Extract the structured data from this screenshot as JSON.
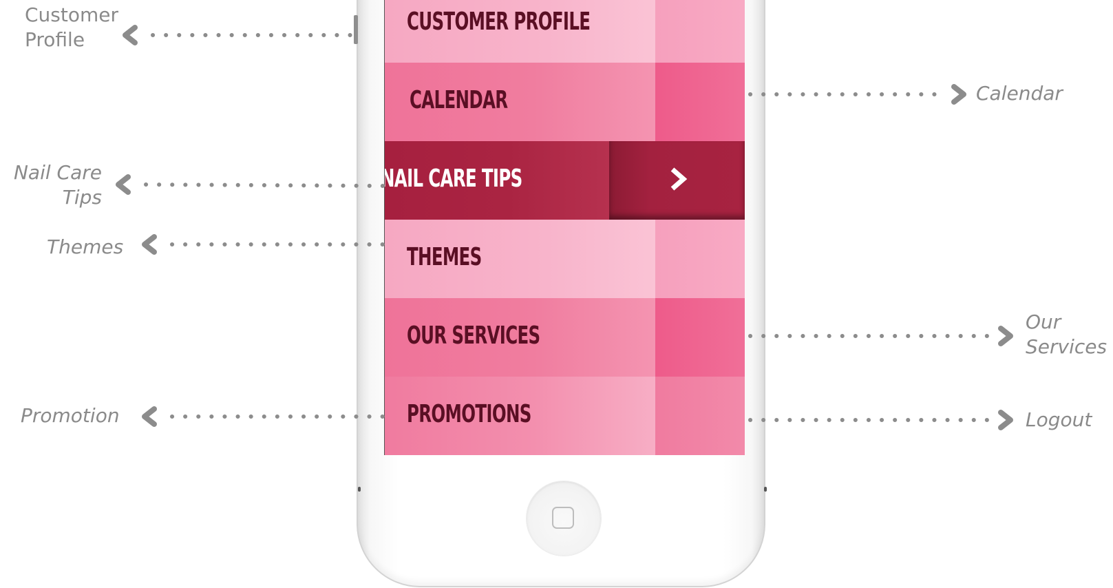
{
  "menu": {
    "items": [
      {
        "label": "CUSTOMER PROFILE"
      },
      {
        "label": "CALENDAR"
      },
      {
        "label": "NAIL CARE TIPS"
      },
      {
        "label": "THEMES"
      },
      {
        "label": "OUR SERVICES"
      },
      {
        "label": "PROMOTIONS"
      }
    ],
    "active_index": 2
  },
  "annotations": {
    "customer_profile": {
      "line1": "Customer",
      "line2": "Profile"
    },
    "calendar": "Calendar",
    "nail_care_tips": {
      "line1": "Nail Care",
      "line2": "Tips"
    },
    "themes": "Themes",
    "our_services": {
      "line1": "Our",
      "line2": "Services"
    },
    "promotion": "Promotion",
    "logout": "Logout"
  },
  "icons": {
    "active_item": "chevron-right-icon",
    "home_button": "home-square-icon",
    "annotation_arrows": "dotted-arrow-icon"
  },
  "colors": {
    "active_item": "#a6203f",
    "light_item": "#f8b4cb",
    "mid_item": "#f07d9f",
    "label_text": "#5a0f24",
    "annotation_text": "#8a8a8a"
  }
}
